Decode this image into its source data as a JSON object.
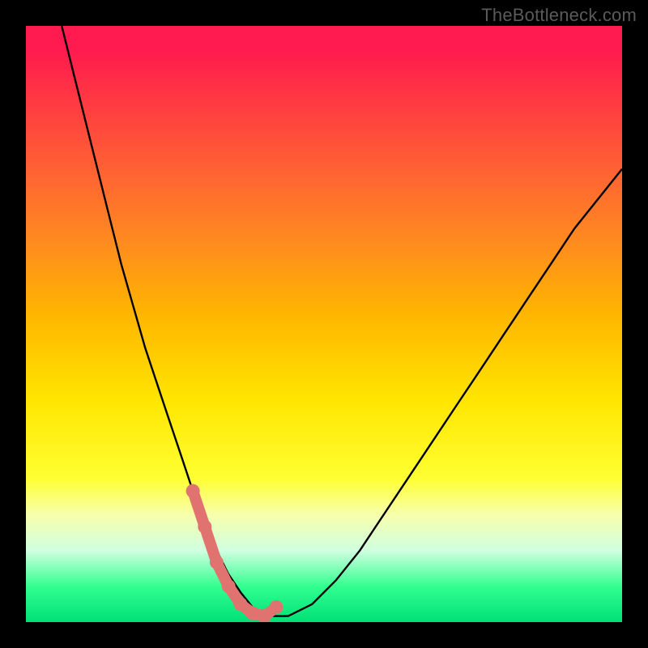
{
  "watermark": "TheBottleneck.com",
  "chart_data": {
    "type": "line",
    "title": "",
    "xlabel": "",
    "ylabel": "",
    "xlim": [
      0,
      100
    ],
    "ylim": [
      0,
      100
    ],
    "grid": false,
    "series": [
      {
        "name": "bottleneck-curve",
        "color": "#000000",
        "x": [
          6,
          8,
          10,
          12,
          14,
          16,
          18,
          20,
          22,
          24,
          26,
          28,
          30,
          32,
          34,
          36,
          38,
          40,
          44,
          48,
          52,
          56,
          60,
          64,
          68,
          72,
          76,
          80,
          84,
          88,
          92,
          96,
          100
        ],
        "values": [
          100,
          92,
          84,
          76,
          68,
          60,
          53,
          46,
          40,
          34,
          28,
          22,
          17,
          12,
          8,
          5,
          2.5,
          1,
          1,
          3,
          7,
          12,
          18,
          24,
          30,
          36,
          42,
          48,
          54,
          60,
          66,
          71,
          76
        ]
      }
    ],
    "highlight_segment": {
      "name": "optimal-range",
      "color": "#e0736f",
      "x": [
        28,
        30,
        32,
        34,
        36,
        38,
        40,
        42
      ],
      "values": [
        22,
        16,
        10,
        6,
        3,
        1.5,
        1,
        2.5
      ],
      "marker_x": [
        28,
        30,
        32,
        34,
        36,
        38,
        40,
        42
      ],
      "marker_y": [
        22,
        16,
        10,
        6,
        3,
        1.5,
        1,
        2.5
      ]
    },
    "gradient_stops": [
      {
        "pos": 0,
        "color": "#ff1a4f"
      },
      {
        "pos": 22,
        "color": "#ff5a36"
      },
      {
        "pos": 48,
        "color": "#ffb400"
      },
      {
        "pos": 63,
        "color": "#ffe600"
      },
      {
        "pos": 82,
        "color": "#f7ffad"
      },
      {
        "pos": 94,
        "color": "#33ff90"
      },
      {
        "pos": 100,
        "color": "#00e077"
      }
    ]
  }
}
